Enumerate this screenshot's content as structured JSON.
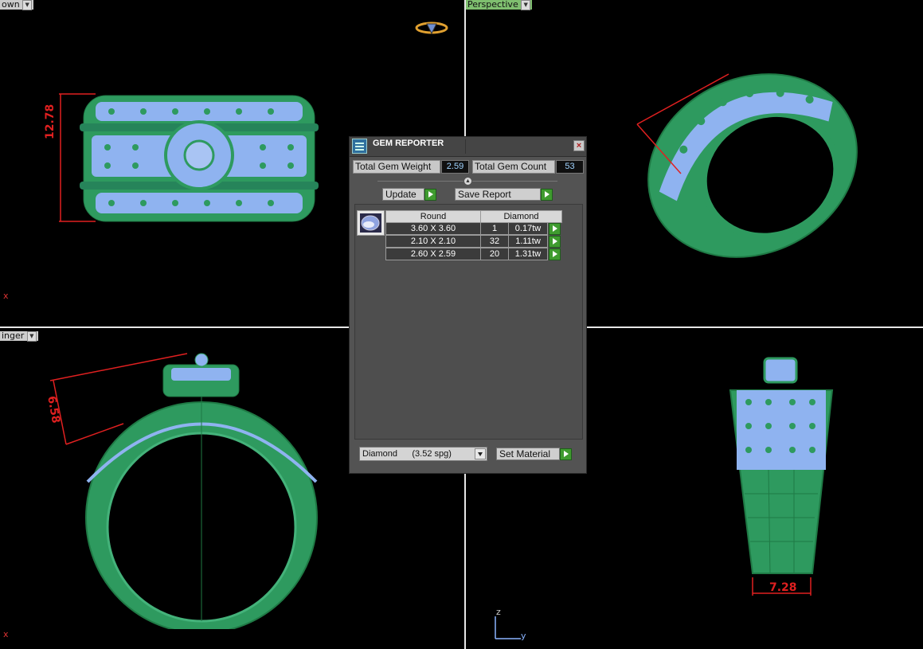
{
  "viewports": {
    "top_left_label": "own",
    "top_right_label": "Perspective",
    "bottom_left_label": "inger",
    "axis_x": "x",
    "axis_z": "z",
    "axis_y": "y"
  },
  "dimensions": {
    "front_height": "12.78",
    "side_height": "6.58",
    "back_width": "7.28"
  },
  "colors": {
    "metal": "#2e9a5f",
    "gem": "#8fb3f0",
    "dimension": "#e02020",
    "accent_button": "#3f9b2f"
  },
  "gem_reporter": {
    "title": "GEM REPORTER",
    "close_icon": "close-icon",
    "total_weight_label": "Total Gem Weight",
    "total_weight_value": "2.59",
    "total_count_label": "Total Gem Count",
    "total_count_value": "53",
    "update_label": "Update",
    "save_report_label": "Save Report",
    "table_headers": [
      "Round",
      "Diamond"
    ],
    "rows": [
      {
        "size": "3.60 X 3.60",
        "count": "1",
        "weight": "0.17tw"
      },
      {
        "size": "2.10 X 2.10",
        "count": "32",
        "weight": "1.11tw"
      },
      {
        "size": "2.60 X 2.59",
        "count": "20",
        "weight": "1.31tw"
      }
    ],
    "material_select": "Diamond      (3.52 spg)",
    "set_material_label": "Set Material"
  }
}
